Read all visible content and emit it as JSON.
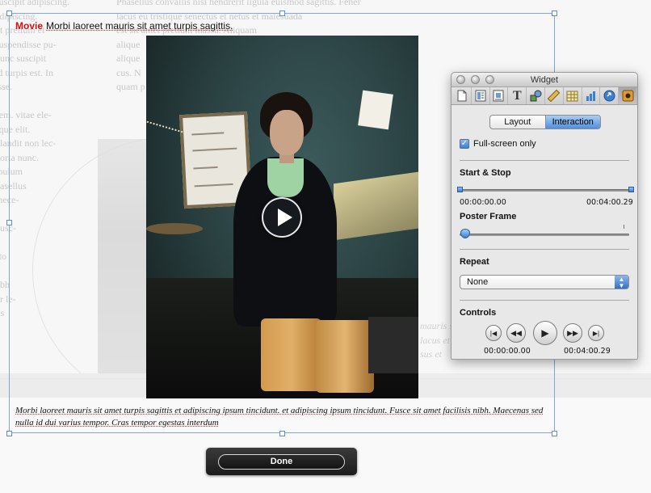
{
  "background": {
    "left_text": "suscipit adipiscing.\nadipiscing.\nut pretium et\nsuspendisse pu-\nnunc suscipit\nid turpis est. In\nisse.\n\nsem. vitae ele-\nsque elit.\nblandit non lec-\nporta nunc.\nibulum\nhasellus\nmece-\n\nbusc-\n\nsto\n\nubh\nur le-\nlis",
    "mid_text": "Phasellus convallis nisi hendrerit ligula euismod sagittis. Fener\nlacus eu tristique senectus et netus et malesuada\nest sit amet pretium massa. Aliquam\nalique\nalique\ncus. N\nquam p",
    "right_text": "mauris se\nlacus et\nsus et"
  },
  "movie": {
    "label": "Movie",
    "subtitle": "Morbi laoreet mauris sit amet turpis sagittis."
  },
  "caption": "Morbi laoreet mauris sit amet turpis sagittis et adipiscing ipsum tincidunt. et adipiscing ipsum tincidunt. Fusce sit amet facilisis nibh. Maecenas sed nulla id dui varius tempor. Cras tempor egestas interdum",
  "done_label": "Done",
  "inspector": {
    "title": "Widget",
    "toolbar_icons": [
      "document-icon",
      "layout-icon",
      "wrap-icon",
      "text-icon",
      "graphic-icon",
      "metrics-icon",
      "table-icon",
      "chart-icon",
      "link-icon",
      "widget-icon"
    ],
    "active_toolbar_index": 9,
    "tabs": [
      "Layout",
      "Interaction"
    ],
    "active_tab": "Interaction",
    "fullscreen_label": "Full-screen only",
    "fullscreen_checked": true,
    "start_stop_label": "Start & Stop",
    "start_time": "00:00:00.00",
    "end_time": "00:04:00.29",
    "poster_frame_label": "Poster Frame",
    "poster_frame_position": 0,
    "repeat_label": "Repeat",
    "repeat_value": "None",
    "controls_label": "Controls",
    "controls_start_time": "00:00:00.00",
    "controls_end_time": "00:04:00.29"
  },
  "colors": {
    "selection": "#7fa7d8",
    "movie_label": "#d21010",
    "accent_blue": "#4f8fdc"
  }
}
